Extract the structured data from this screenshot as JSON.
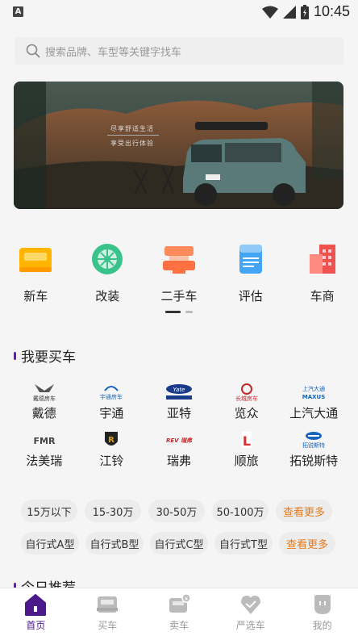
{
  "status_bar": {
    "time": "10:45",
    "app_icon_letter": "A"
  },
  "search": {
    "placeholder": "搜索品牌、车型等关键字找车"
  },
  "banner": {
    "line1": "尽享舒适生活",
    "line2": "享受出行体验"
  },
  "categories": [
    {
      "label": "新车",
      "icon": "new-car-icon"
    },
    {
      "label": "改装",
      "icon": "wheel-icon"
    },
    {
      "label": "二手车",
      "icon": "used-car-icon"
    },
    {
      "label": "评估",
      "icon": "evaluate-icon"
    },
    {
      "label": "车商",
      "icon": "dealer-icon"
    }
  ],
  "buy_section": {
    "title": "我要买车"
  },
  "brands": [
    {
      "name": "戴德",
      "logo_text": "戴德房车"
    },
    {
      "name": "宇通",
      "logo_text": "宇通房车"
    },
    {
      "name": "亚特",
      "logo_text": "Yate"
    },
    {
      "name": "览众",
      "logo_text": "长城房车"
    },
    {
      "name": "上汽大通",
      "logo_text": "MAXUS"
    },
    {
      "name": "法美瑞",
      "logo_text": "FMR"
    },
    {
      "name": "江铃",
      "logo_text": "R"
    },
    {
      "name": "瑞弗",
      "logo_text": "REV 瑞弗"
    },
    {
      "name": "顺旅",
      "logo_text": "L"
    },
    {
      "name": "拓锐斯特",
      "logo_text": "拓锐斯特"
    }
  ],
  "price_chips": [
    "15万以下",
    "15-30万",
    "30-50万",
    "50-100万",
    "查看更多"
  ],
  "type_chips": [
    "自行式A型",
    "自行式B型",
    "自行式C型",
    "自行式T型",
    "查看更多"
  ],
  "today_section": {
    "title": "今日推荐"
  },
  "tabs": [
    {
      "label": "首页",
      "active": true
    },
    {
      "label": "买车",
      "active": false
    },
    {
      "label": "卖车",
      "active": false
    },
    {
      "label": "严选车",
      "active": false
    },
    {
      "label": "我的",
      "active": false
    }
  ],
  "colors": {
    "accent": "#4a1a8a",
    "more": "#e87a1d",
    "chip_bg": "#ececec"
  }
}
